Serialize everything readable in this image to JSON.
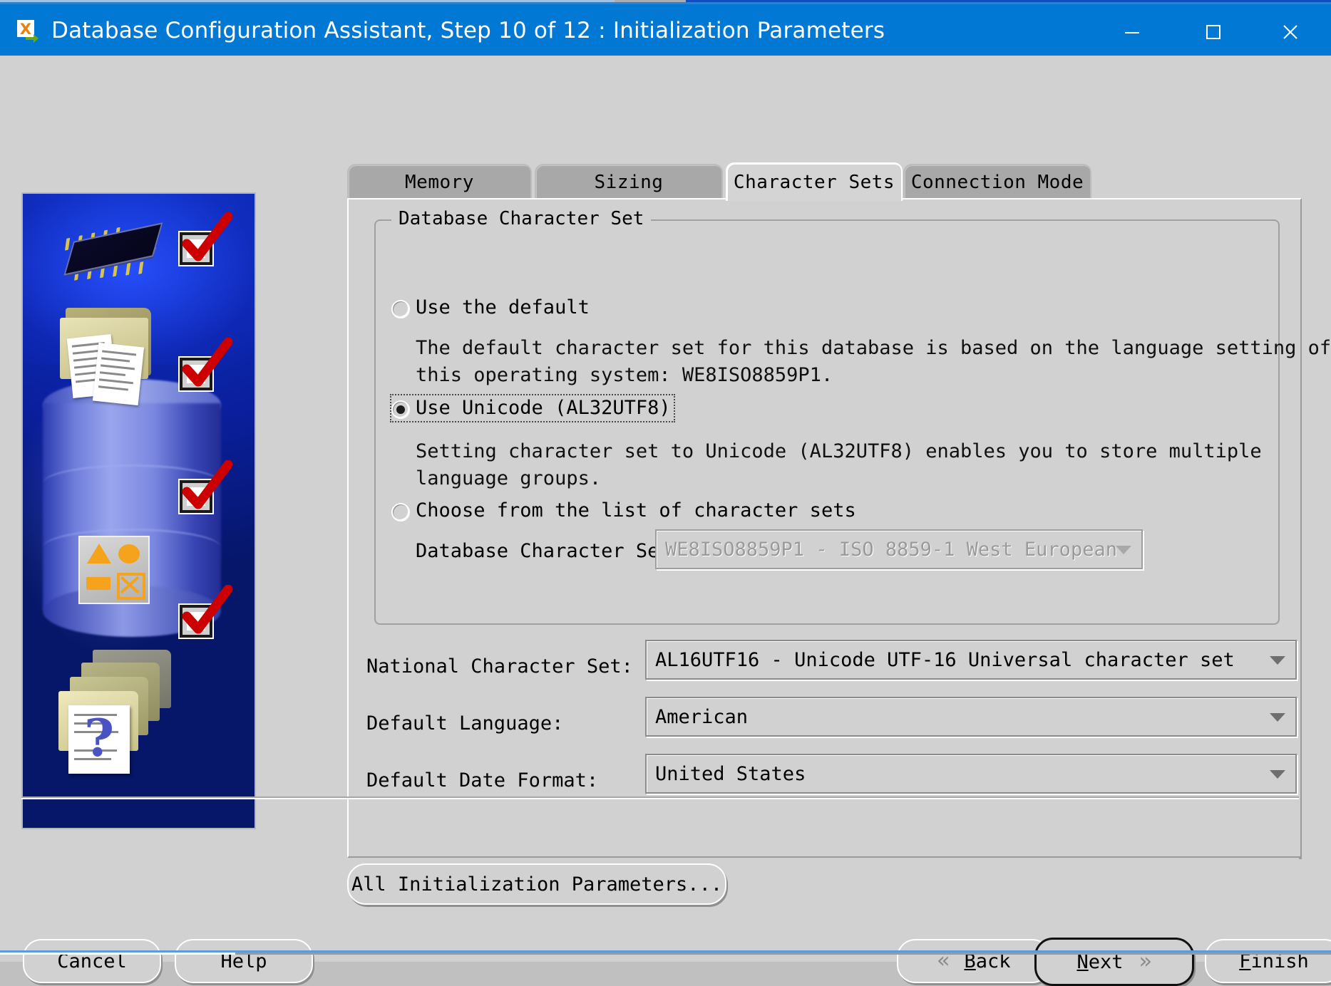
{
  "window": {
    "title": "Database Configuration Assistant, Step 10 of 12 : Initialization Parameters",
    "app_icon": "oracle-dbca-icon",
    "minimize_label": "Minimize",
    "maximize_label": "Maximize",
    "close_label": "Close",
    "titlebar_color": "#0078d4"
  },
  "banner": {
    "alt": "database-configuration-illustration",
    "checkmarks": 4
  },
  "tabs": [
    {
      "id": "memory",
      "label": "Memory",
      "active": false
    },
    {
      "id": "sizing",
      "label": "Sizing",
      "active": false
    },
    {
      "id": "charsets",
      "label": "Character Sets",
      "active": true
    },
    {
      "id": "connmode",
      "label": "Connection Mode",
      "active": false
    }
  ],
  "group": {
    "title": "Database Character Set",
    "options": [
      {
        "id": "use-default",
        "label": "Use the default",
        "selected": false,
        "focused": false,
        "description_lines": [
          "The default character set for this database is based on the language setting of",
          "this operating system: WE8ISO8859P1."
        ]
      },
      {
        "id": "use-unicode",
        "label": "Use Unicode (AL32UTF8)",
        "selected": true,
        "focused": true,
        "description_lines": [
          "Setting character set to Unicode (AL32UTF8) enables you to store multiple",
          "language groups."
        ]
      },
      {
        "id": "choose-from-list",
        "label": "Choose from the list of character sets",
        "selected": false,
        "focused": false,
        "description_lines": []
      }
    ],
    "db_charset_field": {
      "label": "Database Character Set:",
      "value": "WE8ISO8859P1 - ISO 8859-1 West European",
      "disabled": true
    }
  },
  "fields": [
    {
      "id": "national-character-set",
      "label": "National Character Set:",
      "value": "AL16UTF16 - Unicode UTF-16 Universal character set"
    },
    {
      "id": "default-language",
      "label": "Default Language:",
      "value": "American"
    },
    {
      "id": "default-date-format",
      "label": "Default Date Format:",
      "value": "United States"
    }
  ],
  "all_params_button": {
    "label": "All Initialization Parameters..."
  },
  "footer": {
    "cancel": "Cancel",
    "help": "Help",
    "back": "Back",
    "back_mnemonic": "B",
    "next": "Next",
    "next_mnemonic": "N",
    "finish": "Finish",
    "finish_mnemonic": "F",
    "back_icon": "chevron-double-left-icon",
    "next_icon": "chevron-double-right-icon"
  }
}
